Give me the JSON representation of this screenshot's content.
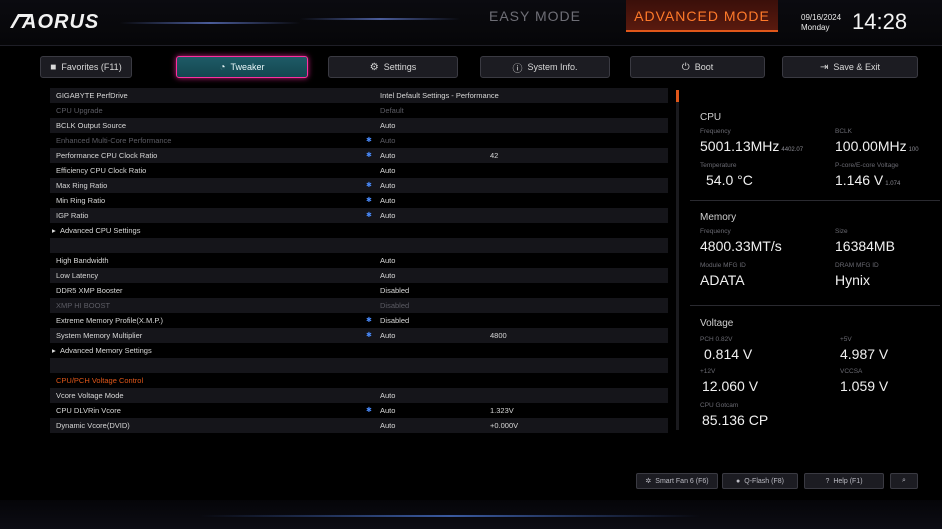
{
  "header": {
    "brand": "AORUS",
    "easy_mode": "EASY MODE",
    "advanced_mode": "ADVANCED MODE",
    "date": "09/16/2024",
    "weekday": "Monday",
    "time": "14:28",
    "accent_color": "#e0571a"
  },
  "tabs": [
    {
      "label": "Favorites (F11)",
      "icon": "star-folder-icon"
    },
    {
      "label": "Tweaker",
      "icon": "gauge-icon"
    },
    {
      "label": "Settings",
      "icon": "gear-icon"
    },
    {
      "label": "System Info.",
      "icon": "info-icon"
    },
    {
      "label": "Boot",
      "icon": "power-icon"
    },
    {
      "label": "Save & Exit",
      "icon": "exit-icon"
    }
  ],
  "settings": [
    {
      "label": "GIGABYTE PerfDrive",
      "value": "Intel Default Settings - Performance",
      "value2": "",
      "star": false,
      "dim": false
    },
    {
      "label": "CPU Upgrade",
      "value": "Default",
      "value2": "",
      "star": false,
      "dim": true
    },
    {
      "label": "BCLK Output Source",
      "value": "Auto",
      "value2": "",
      "star": false,
      "dim": false
    },
    {
      "label": "Enhanced Multi-Core Performance",
      "value": "Auto",
      "value2": "",
      "star": true,
      "dim": true
    },
    {
      "label": "Performance CPU Clock Ratio",
      "value": "Auto",
      "value2": "42",
      "star": true,
      "dim": false
    },
    {
      "label": "Efficiency CPU Clock Ratio",
      "value": "Auto",
      "value2": "",
      "star": false,
      "dim": false
    },
    {
      "label": "Max Ring Ratio",
      "value": "Auto",
      "value2": "",
      "star": true,
      "dim": false
    },
    {
      "label": "Min Ring Ratio",
      "value": "Auto",
      "value2": "",
      "star": true,
      "dim": false
    },
    {
      "label": "IGP Ratio",
      "value": "Auto",
      "value2": "",
      "star": true,
      "dim": false
    },
    {
      "label": "Advanced CPU Settings",
      "value": "",
      "value2": "",
      "star": false,
      "dim": false,
      "sub": true
    },
    {
      "label": "",
      "value": "",
      "value2": "",
      "star": false,
      "dim": false
    },
    {
      "label": "High Bandwidth",
      "value": "Auto",
      "value2": "",
      "star": false,
      "dim": false
    },
    {
      "label": "Low Latency",
      "value": "Auto",
      "value2": "",
      "star": false,
      "dim": false
    },
    {
      "label": "DDR5 XMP Booster",
      "value": "Disabled",
      "value2": "",
      "star": false,
      "dim": false
    },
    {
      "label": "XMP HI BOOST",
      "value": "Disabled",
      "value2": "",
      "star": false,
      "dim": true
    },
    {
      "label": "Extreme Memory Profile(X.M.P.)",
      "value": "Disabled",
      "value2": "",
      "star": true,
      "dim": false
    },
    {
      "label": "System Memory Multiplier",
      "value": "Auto",
      "value2": "4800",
      "star": true,
      "dim": false
    },
    {
      "label": "Advanced Memory Settings",
      "value": "",
      "value2": "",
      "star": false,
      "dim": false,
      "sub": true
    },
    {
      "label": "",
      "value": "",
      "value2": "",
      "star": false,
      "dim": false
    },
    {
      "label": "CPU/PCH Voltage Control",
      "value": "",
      "value2": "",
      "star": false,
      "dim": false,
      "hl": true
    },
    {
      "label": "Vcore Voltage Mode",
      "value": "Auto",
      "value2": "",
      "star": false,
      "dim": false
    },
    {
      "label": "CPU DLVRin Vcore",
      "value": "Auto",
      "value2": "1.323V",
      "star": true,
      "dim": false
    },
    {
      "label": "Dynamic Vcore(DVID)",
      "value": "Auto",
      "value2": "+0.000V",
      "star": false,
      "dim": false
    }
  ],
  "hardware": {
    "cpu": {
      "title": "CPU",
      "freq_label": "Frequency",
      "freq_value": "5001.13MHz",
      "freq_note": "4402.07",
      "bclk_label": "BCLK",
      "bclk_value": "100.00MHz",
      "bclk_note": "100",
      "temp_label": "Temperature",
      "temp_value": "54.0 °C",
      "volt_label": "P-core/E-core Voltage",
      "volt_value": "1.146 V",
      "volt_note": "1.074"
    },
    "memory": {
      "title": "Memory",
      "freq_label": "Frequency",
      "freq_value": "4800.33MT/s",
      "size_label": "Size",
      "size_value": "16384MB",
      "module_label": "Module MFG ID",
      "module_value": "ADATA",
      "dram_label": "DRAM MFG ID",
      "dram_value": "Hynix"
    },
    "voltage": {
      "title": "Voltage",
      "pch_label": "PCH 0.82V",
      "pch_value": "0.814 V",
      "v5_label": "+5V",
      "v5_value": "4.987 V",
      "v12_label": "+12V",
      "v12_value": "12.060 V",
      "vccsa_label": "VCCSA",
      "vccsa_value": "1.059 V",
      "cp_label": "CPU Gotcam",
      "cp_value": "85.136 CP"
    }
  },
  "bottom": {
    "smart_fan": "Smart Fan 6 (F6)",
    "qflash": "Q-Flash (F8)",
    "help": "Help (F1)",
    "search_icon": "search-icon"
  }
}
